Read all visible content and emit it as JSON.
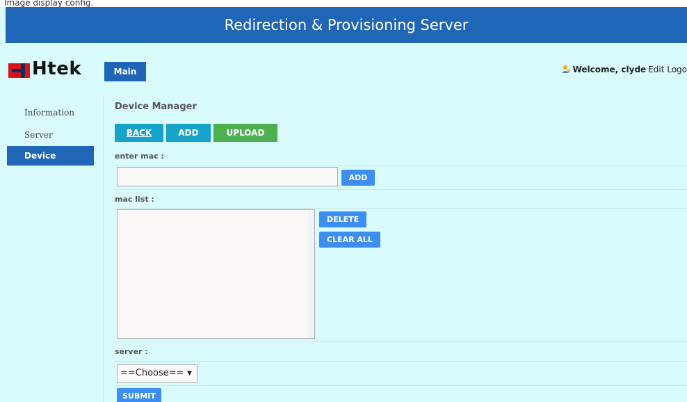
{
  "caption": "Image display config.",
  "header": {
    "title": "Redirection & Provisioning Server"
  },
  "logo": {
    "text": "Htek"
  },
  "top_tab": {
    "label": "Main"
  },
  "user": {
    "welcome": "Welcome, clyde",
    "actions": "Edit Logo"
  },
  "sidebar": {
    "items": [
      {
        "label": "Information",
        "active": false
      },
      {
        "label": "Server",
        "active": false
      },
      {
        "label": "Device",
        "active": true
      }
    ]
  },
  "content": {
    "title": "Device Manager",
    "nav_buttons": {
      "back": "BACK",
      "add": "ADD",
      "upload": "UPLOAD"
    },
    "enter_mac_label": "enter mac :",
    "enter_mac_value": "",
    "add_button": "ADD",
    "mac_list_label": "mac list :",
    "mac_list_items": [],
    "delete_button": "DELETE",
    "clear_all_button": "CLEAR ALL",
    "server_label": "server :",
    "server_selected": "==Choose==",
    "submit_button": "SUBMIT"
  },
  "colors": {
    "primary_blue": "#1f66b7",
    "cyan_button": "#17a2c9",
    "green_button": "#4caf50",
    "small_button": "#3d8ef0",
    "page_background": "#d9fbfb",
    "logo_red": "#d81418",
    "logo_navy": "#0e2e63"
  }
}
